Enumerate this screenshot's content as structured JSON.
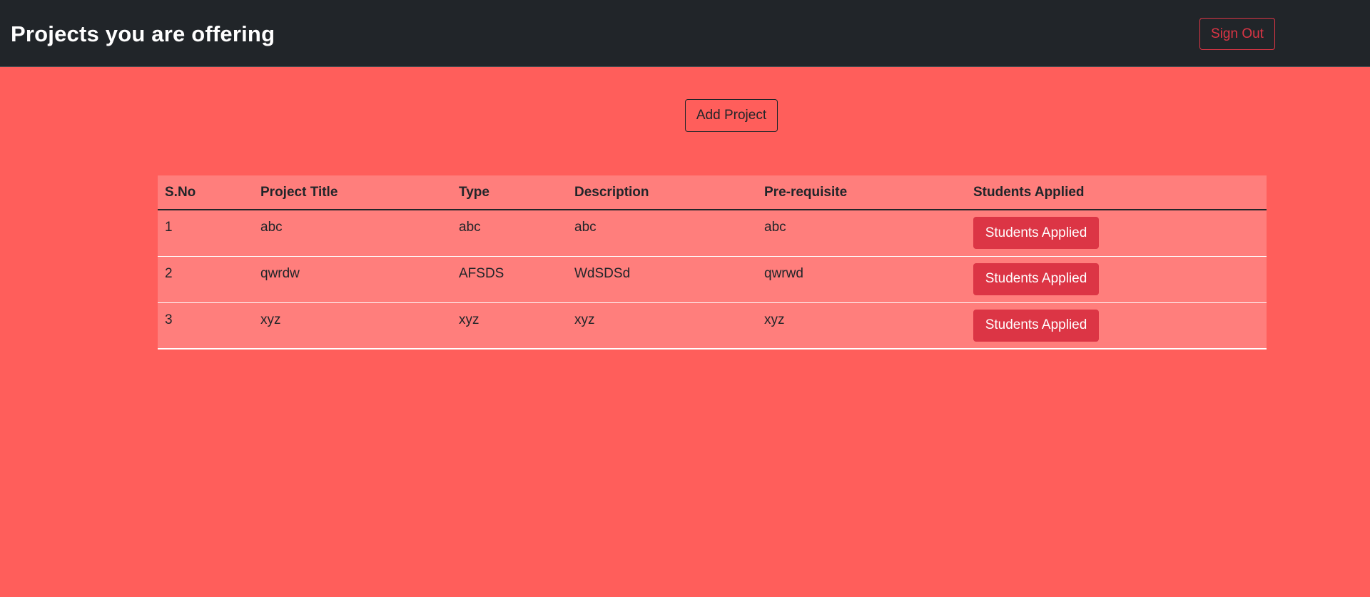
{
  "header": {
    "title": "Projects you are offering",
    "signout_label": "Sign Out"
  },
  "toolbar": {
    "add_project_label": "Add Project"
  },
  "table": {
    "columns": [
      "S.No",
      "Project Title",
      "Type",
      "Description",
      "Pre-requisite",
      "Students Applied"
    ],
    "rows": [
      {
        "sno": "1",
        "title": "abc",
        "type": "abc",
        "description": "abc",
        "prerequisite": "abc",
        "action_label": "Students Applied"
      },
      {
        "sno": "2",
        "title": "qwrdw",
        "type": "AFSDS",
        "description": "WdSDSd",
        "prerequisite": "qwrwd",
        "action_label": "Students Applied"
      },
      {
        "sno": "3",
        "title": "xyz",
        "type": "xyz",
        "description": "xyz",
        "prerequisite": "xyz",
        "action_label": "Students Applied"
      }
    ]
  },
  "colors": {
    "page_background": "#ff5e5b",
    "navbar_background": "#212529",
    "table_background": "#ff7e7c",
    "danger": "#dc3545"
  }
}
